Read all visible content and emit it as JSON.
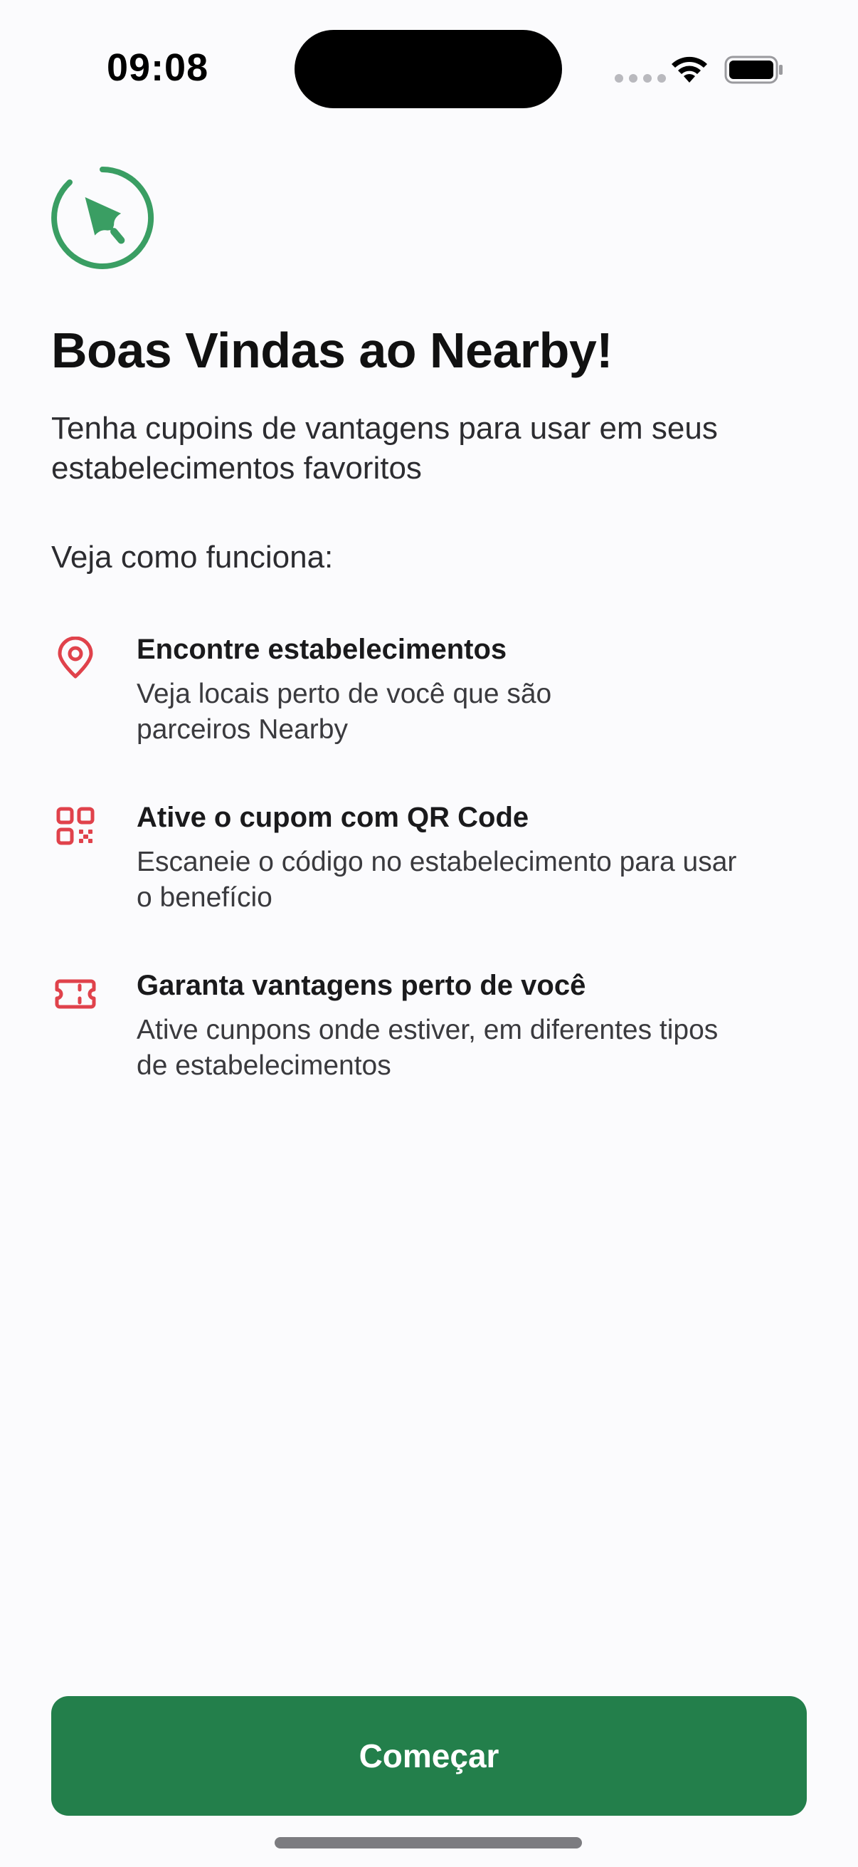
{
  "status_bar": {
    "time": "09:08"
  },
  "welcome": {
    "title": "Boas Vindas ao Nearby!",
    "subtitle": "Tenha cupoins de vantagens para usar em seus estabelecimentos favoritos",
    "how_it_works": "Veja como funciona:"
  },
  "features": [
    {
      "icon": "map-pin-icon",
      "title": "Encontre estabelecimentos",
      "description_line1": "Veja locais perto de você que são",
      "description_line2": "parceiros Nearby"
    },
    {
      "icon": "qrcode-icon",
      "title": "Ative o cupom com QR Code",
      "description_line1": "Escaneie o código no estabelecimento para usar",
      "description_line2": "o benefício"
    },
    {
      "icon": "ticket-icon",
      "title": "Garanta vantagens perto de você",
      "description_line1": "Ative cunpons onde estiver, em diferentes tipos",
      "description_line2": "de estabelecimentos"
    }
  ],
  "start_button": {
    "label": "Começar"
  },
  "colors": {
    "brand_green": "#237F4B",
    "logo_green": "#3A9E63",
    "icon_red": "#E0424B",
    "background": "#FBFBFD"
  }
}
